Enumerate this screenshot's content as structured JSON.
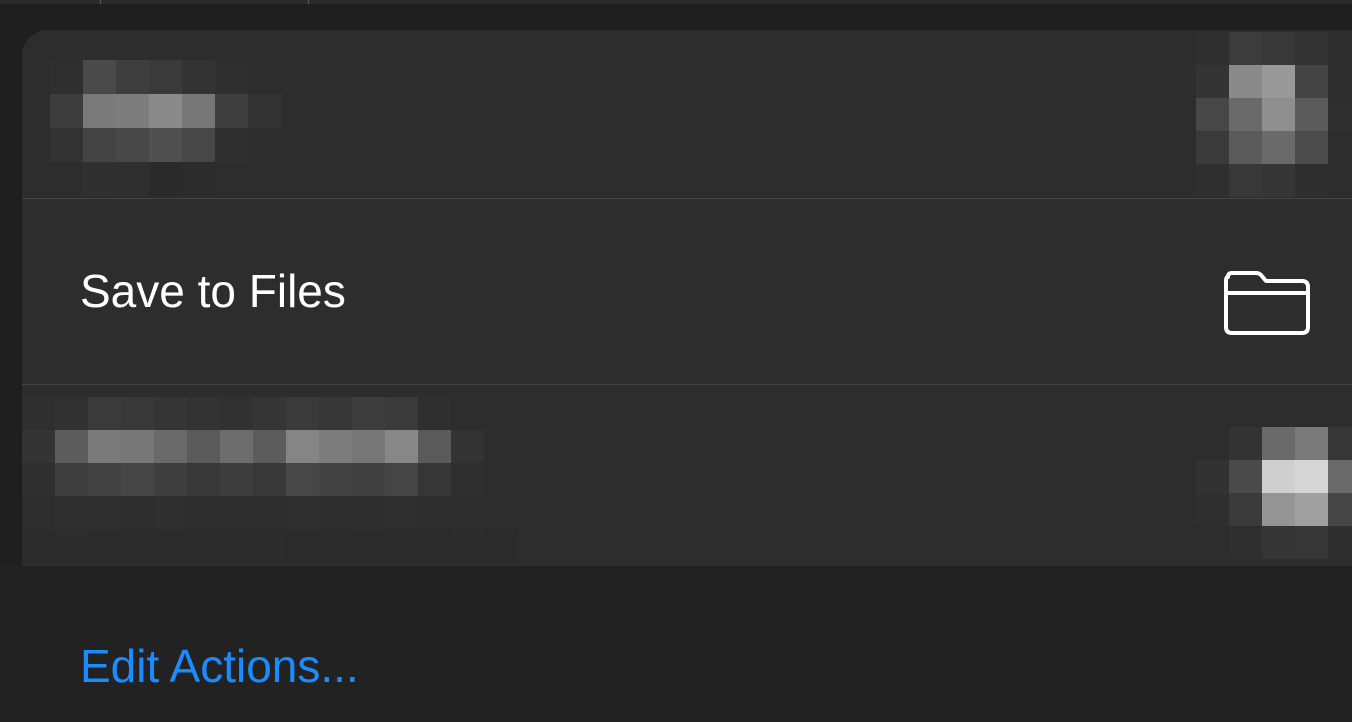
{
  "sheet": {
    "rows": [
      {
        "label": "",
        "icon": "redacted-icon",
        "redacted": true
      },
      {
        "label": "Save to Files",
        "icon": "folder-icon",
        "redacted": false
      },
      {
        "label": "",
        "icon": "redacted-icon",
        "redacted": true
      }
    ]
  },
  "footer": {
    "edit_actions_label": "Edit Actions..."
  },
  "colors": {
    "background": "#1f1f1f",
    "sheet": "#2d2d2d",
    "divider": "#454545",
    "text": "#ffffff",
    "link": "#1b8cff"
  }
}
